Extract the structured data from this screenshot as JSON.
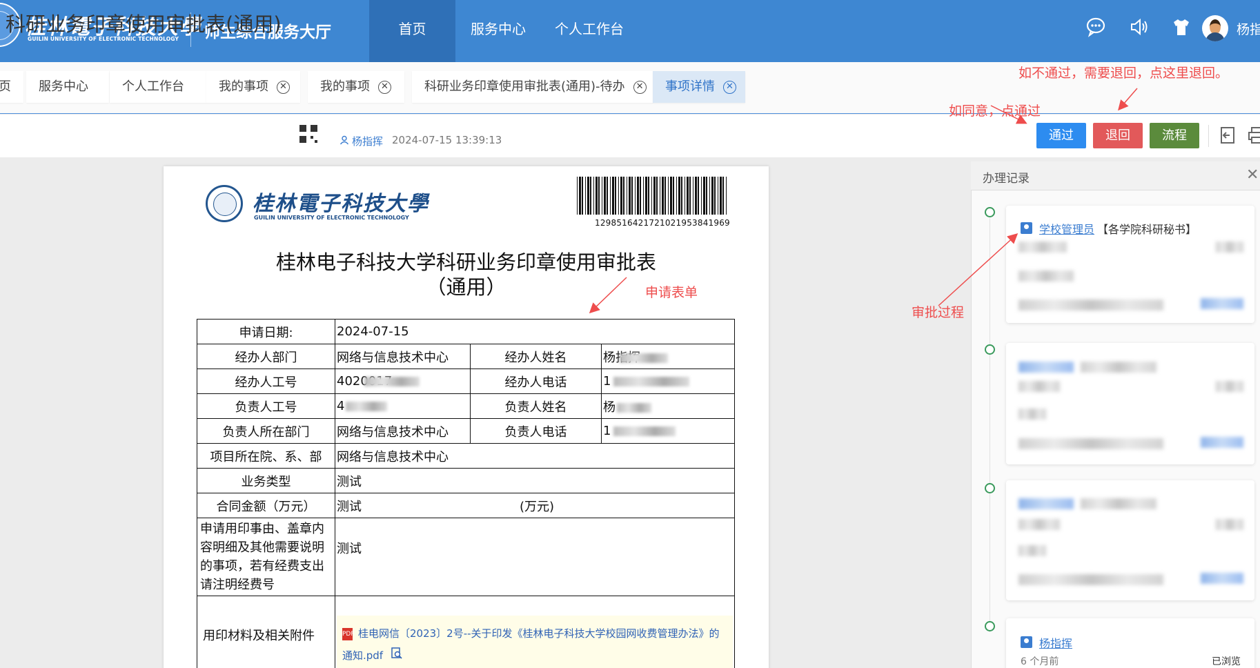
{
  "header": {
    "logo_cn": "桂林電子科技大學",
    "logo_en": "GUILIN UNIVERSITY OF ELECTRONIC TECHNOLOGY",
    "hall_title": "师生综合服务大厅",
    "nav": [
      {
        "label": "首页",
        "active": true
      },
      {
        "label": "服务中心",
        "active": false
      },
      {
        "label": "个人工作台",
        "active": false
      }
    ],
    "icons": [
      "chat-icon",
      "sound-icon",
      "shirt-icon"
    ],
    "user_name": "杨指挥"
  },
  "tabs": [
    {
      "label": "页",
      "closable": false
    },
    {
      "label": "服务中心",
      "closable": false
    },
    {
      "label": "个人工作台",
      "closable": false
    },
    {
      "label": "我的事项",
      "closable": true
    },
    {
      "label": "我的事项",
      "closable": true
    },
    {
      "label": "科研业务印章使用审批表(通用)-待办",
      "closable": true
    },
    {
      "label": "事项详情",
      "closable": true,
      "active": true
    }
  ],
  "title_row": {
    "title": "科研业务印章使用审批表(通用)",
    "creator": "杨指挥",
    "created_time": "2024-07-15 13:39:13",
    "buttons": {
      "approve": "通过",
      "return": "退回",
      "flow": "流程"
    }
  },
  "document": {
    "logo_cn": "桂林電子科技大學",
    "logo_en": "GUILIN UNIVERSITY OF ELECTRONIC TECHNOLOGY",
    "barcode_number": "1298516421721021953841969",
    "title_line1": "桂林电子科技大学科研业务印章使用审批表",
    "title_line2": "（通用）",
    "form": {
      "apply_date_label": "申请日期:",
      "apply_date": "2024-07-15",
      "handler_dept_label": "经办人部门",
      "handler_dept": "网络与信息技术中心",
      "handler_name_label": "经办人姓名",
      "handler_name": "杨指挥",
      "handler_id_label": "经办人工号",
      "handler_id": "4020017",
      "handler_phone_label": "经办人电话",
      "handler_phone": "1",
      "leader_id_label": "负责人工号",
      "leader_id": "4",
      "leader_name_label": "负责人姓名",
      "leader_name": "杨",
      "leader_dept_label": "负责人所在部门",
      "leader_dept": "网络与信息技术中心",
      "leader_phone_label": "负责人电话",
      "leader_phone": "1",
      "project_dept_label": "项目所在院、系、部",
      "project_dept": "网络与信息技术中心",
      "biz_type_label": "业务类型",
      "biz_type": "测试",
      "amount_label": "合同金额（万元）",
      "amount": "测试",
      "amount_unit": "(万元)",
      "reason_label": "申请用印事由、盖章内容明细及其他需要说明的事项，若有经费支出请注明经费号",
      "reason": "测试",
      "attachments_label": "用印材料及相关附件",
      "attachment_file": "桂电网信〔2023〕2号--关于印发《桂林电子科技大学校园网收费管理办法》的通知.pdf"
    }
  },
  "panel": {
    "title": "办理记录",
    "records": [
      {
        "name": "学校管理员",
        "role": "【各学院科研秘书】",
        "blurred": true
      },
      {
        "blurred": true
      },
      {
        "blurred": true
      },
      {
        "name": "杨指挥",
        "time": "6 个月前",
        "status": "已浏览"
      }
    ]
  },
  "annotations": {
    "return_hint": "如不通过，需要退回，点这里退回。",
    "approve_hint": "如同意，点通过",
    "form_hint": "申请表单",
    "process_hint": "审批过程"
  },
  "colors": {
    "topbar": "#3e87d2",
    "nav_active": "#2f70b7",
    "approve": "#2d8cf0",
    "return": "#e2595a",
    "flow": "#5b8b3c",
    "annotation": "#ee4d4d"
  }
}
